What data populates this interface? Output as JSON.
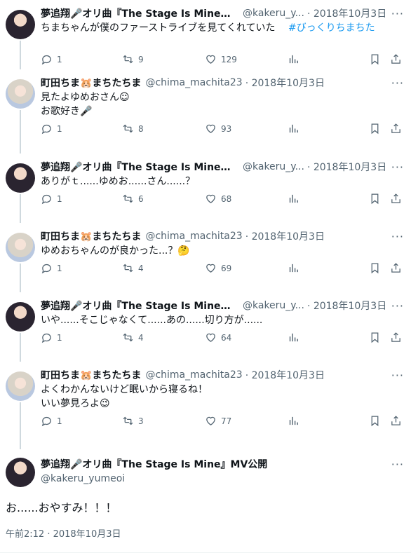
{
  "tweets": [
    {
      "name": "夢追翔🎤オリ曲『The Stage Is Mine』...",
      "handle": "@kakeru_y...",
      "date": "· 2018年10月3日",
      "text": "ちまちゃんが僕のファーストライブを見てくれていた",
      "hashtag": "#びっくりちまちた",
      "replies": "1",
      "retweets": "9",
      "likes": "129"
    },
    {
      "name": "町田ちま🐹まちたちま",
      "handle": "@chima_machita23",
      "date": "· 2018年10月3日",
      "line1": "見たよゆめおさん☺",
      "line2": "お歌好き🎤",
      "replies": "1",
      "retweets": "8",
      "likes": "93"
    },
    {
      "name": "夢追翔🎤オリ曲『The Stage Is Mine』...",
      "handle": "@kakeru_y...",
      "date": "· 2018年10月3日",
      "text": "ありがｔ......ゆめお......さん......？",
      "replies": "1",
      "retweets": "6",
      "likes": "68"
    },
    {
      "name": "町田ちま🐹まちたちま",
      "handle": "@chima_machita23",
      "date": "· 2018年10月3日",
      "text": "ゆめおちゃんのが良かった...？🤔",
      "replies": "1",
      "retweets": "4",
      "likes": "69"
    },
    {
      "name": "夢追翔🎤オリ曲『The Stage Is Mine』...",
      "handle": "@kakeru_y...",
      "date": "· 2018年10月3日",
      "text": "いや......そこじゃなくて......あの......切り方が......",
      "replies": "1",
      "retweets": "4",
      "likes": "64"
    },
    {
      "name": "町田ちま🐹まちたちま",
      "handle": "@chima_machita23",
      "date": "· 2018年10月3日",
      "line1": "よくわかんないけど眠いから寝るね！",
      "line2": "いい夢見ろよ😉",
      "replies": "1",
      "retweets": "3",
      "likes": "77"
    }
  ],
  "main": {
    "name": "夢追翔🎤オリ曲『The Stage Is Mine』MV公開",
    "handle": "@kakeru_yumeoi",
    "text": "お......おやすみ！！！",
    "time": "午前2:12 · 2018年10月3日"
  },
  "icons": [
    "reply-icon",
    "retweet-icon",
    "like-icon",
    "views-icon",
    "bookmark-icon",
    "share-icon",
    "more-icon"
  ],
  "colors": {
    "text": "#0f1419",
    "secondary": "#536471",
    "link": "#1d9bf0",
    "thread": "#cfd9de"
  }
}
